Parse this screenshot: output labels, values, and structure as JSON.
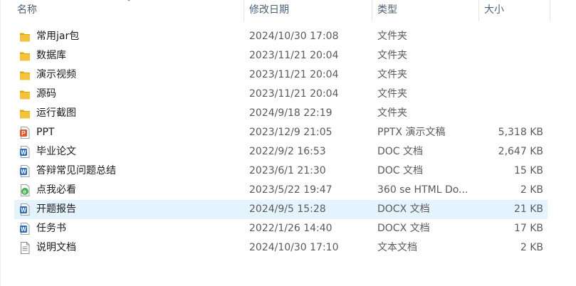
{
  "columns": {
    "name": "名称",
    "date": "修改日期",
    "type": "类型",
    "size": "大小"
  },
  "files": [
    {
      "name": "常用jar包",
      "date": "2024/10/30 17:08",
      "type": "文件夹",
      "size": "",
      "icon": "folder-icon",
      "selected": false
    },
    {
      "name": "数据库",
      "date": "2023/11/21 20:04",
      "type": "文件夹",
      "size": "",
      "icon": "folder-icon",
      "selected": false
    },
    {
      "name": "演示视频",
      "date": "2023/11/21 20:04",
      "type": "文件夹",
      "size": "",
      "icon": "folder-icon",
      "selected": false
    },
    {
      "name": "源码",
      "date": "2023/11/21 20:04",
      "type": "文件夹",
      "size": "",
      "icon": "folder-icon",
      "selected": false
    },
    {
      "name": "运行截图",
      "date": "2024/9/18 22:19",
      "type": "文件夹",
      "size": "",
      "icon": "folder-icon",
      "selected": false
    },
    {
      "name": "PPT",
      "date": "2023/12/9 21:05",
      "type": "PPTX 演示文稿",
      "size": "5,318 KB",
      "icon": "pptx-file-icon",
      "selected": false
    },
    {
      "name": "毕业论文",
      "date": "2022/9/2 16:53",
      "type": "DOC 文档",
      "size": "2,647 KB",
      "icon": "doc-file-icon",
      "selected": false
    },
    {
      "name": "答辩常见问题总结",
      "date": "2023/6/1 21:30",
      "type": "DOC 文档",
      "size": "15 KB",
      "icon": "doc-file-icon",
      "selected": false
    },
    {
      "name": "点我必看",
      "date": "2023/5/22 19:47",
      "type": "360 se HTML Do...",
      "size": "2 KB",
      "icon": "html-file-icon",
      "selected": false
    },
    {
      "name": "开题报告",
      "date": "2024/9/5 15:28",
      "type": "DOCX 文档",
      "size": "21 KB",
      "icon": "docx-file-icon",
      "selected": true
    },
    {
      "name": "任务书",
      "date": "2022/1/26 14:40",
      "type": "DOCX 文档",
      "size": "17 KB",
      "icon": "docx-file-icon",
      "selected": false
    },
    {
      "name": "说明文档",
      "date": "2024/10/30 17:10",
      "type": "文本文档",
      "size": "2 KB",
      "icon": "txt-file-icon",
      "selected": false
    }
  ],
  "colors": {
    "folder": "#f5c33b",
    "ppt": "#e4572e",
    "word": "#2b6cc4",
    "html": "#4caf50",
    "selected_bg": "#e5f3ff",
    "header_text": "#4c607a"
  }
}
